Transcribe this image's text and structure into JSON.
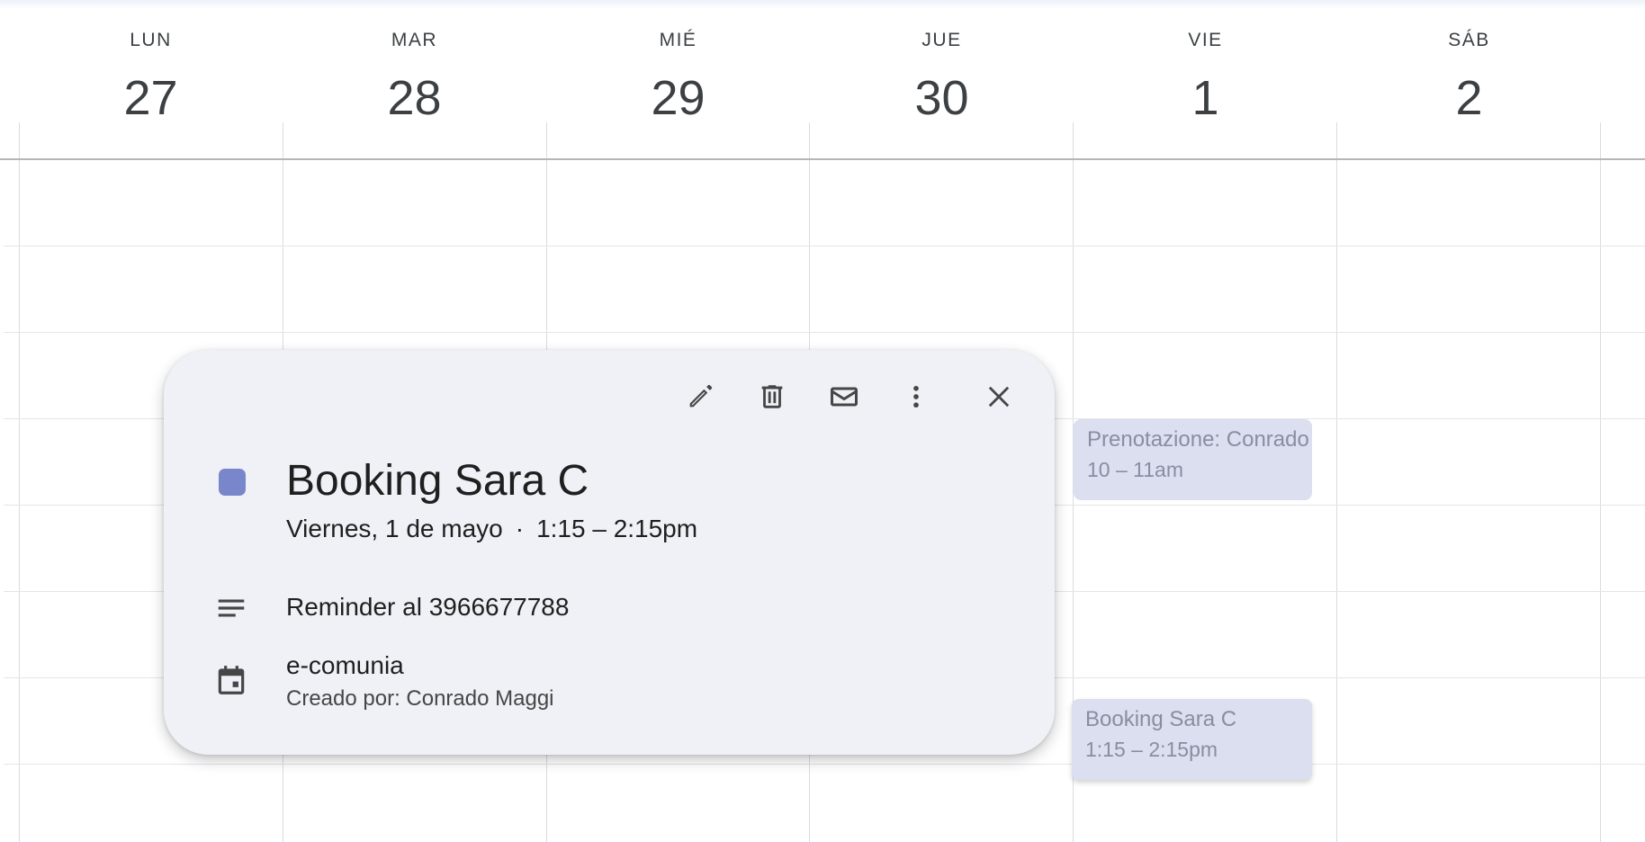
{
  "week": {
    "days": [
      {
        "dow": "LUN",
        "num": "27"
      },
      {
        "dow": "MAR",
        "num": "28"
      },
      {
        "dow": "MIÉ",
        "num": "29"
      },
      {
        "dow": "JUE",
        "num": "30"
      },
      {
        "dow": "VIE",
        "num": "1"
      },
      {
        "dow": "SÁB",
        "num": "2"
      }
    ]
  },
  "events": {
    "prenotazione": {
      "title": "Prenotazione: Conrado",
      "time": "10 – 11am"
    },
    "booking": {
      "title": "Booking Sara C",
      "time": "1:15 – 2:15pm"
    }
  },
  "popup": {
    "title": "Booking Sara C",
    "date": "Viernes, 1 de mayo",
    "separator": "·",
    "time": "1:15 – 2:15pm",
    "description": "Reminder al 3966677788",
    "calendar_name": "e-comunia",
    "creator": "Creado por: Conrado Maggi",
    "event_color": "#7986cb",
    "icons": {
      "edit": "pencil-icon",
      "delete": "trash-icon",
      "email": "mail-icon",
      "more": "more-vert-icon",
      "close": "close-icon",
      "description": "notes-icon",
      "calendar": "calendar-icon"
    }
  }
}
